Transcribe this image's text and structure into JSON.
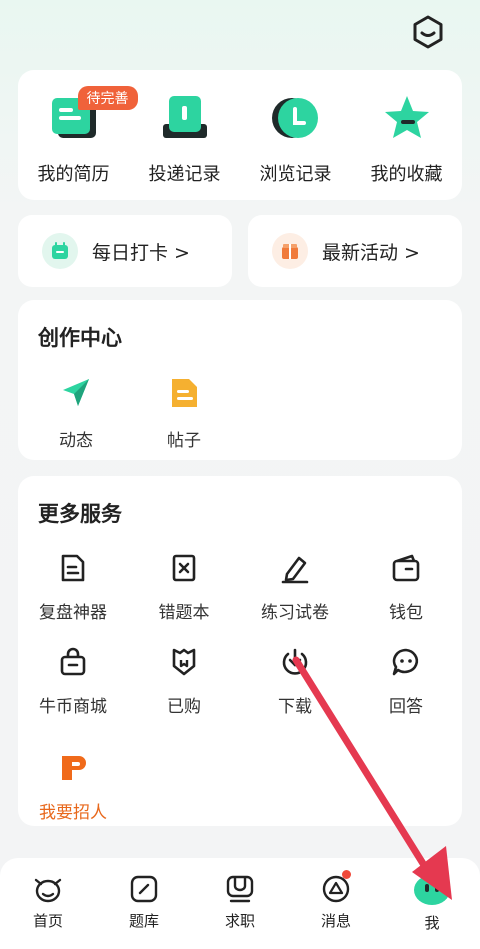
{
  "quick": [
    {
      "label": "我的简历",
      "badge": "待完善",
      "icon": "resume-icon"
    },
    {
      "label": "投递记录",
      "icon": "delivery-icon"
    },
    {
      "label": "浏览记录",
      "icon": "history-icon"
    },
    {
      "label": "我的收藏",
      "icon": "star-icon"
    }
  ],
  "checkin": {
    "label": "每日打卡 >"
  },
  "activity": {
    "label": "最新活动 >"
  },
  "create": {
    "title": "创作中心",
    "items": [
      {
        "label": "动态"
      },
      {
        "label": "帖子"
      }
    ]
  },
  "services": {
    "title": "更多服务",
    "items": [
      {
        "label": "复盘神器"
      },
      {
        "label": "错题本"
      },
      {
        "label": "练习试卷"
      },
      {
        "label": "钱包"
      },
      {
        "label": "牛币商城"
      },
      {
        "label": "已购"
      },
      {
        "label": "下载"
      },
      {
        "label": "回答"
      },
      {
        "label": "我要招人"
      }
    ]
  },
  "nav": [
    {
      "label": "首页"
    },
    {
      "label": "题库"
    },
    {
      "label": "求职"
    },
    {
      "label": "消息"
    },
    {
      "label": "我"
    }
  ],
  "colors": {
    "accent": "#2dcf9e",
    "orange": "#f5a623",
    "red": "#e53950",
    "badge": "#f0623a"
  }
}
